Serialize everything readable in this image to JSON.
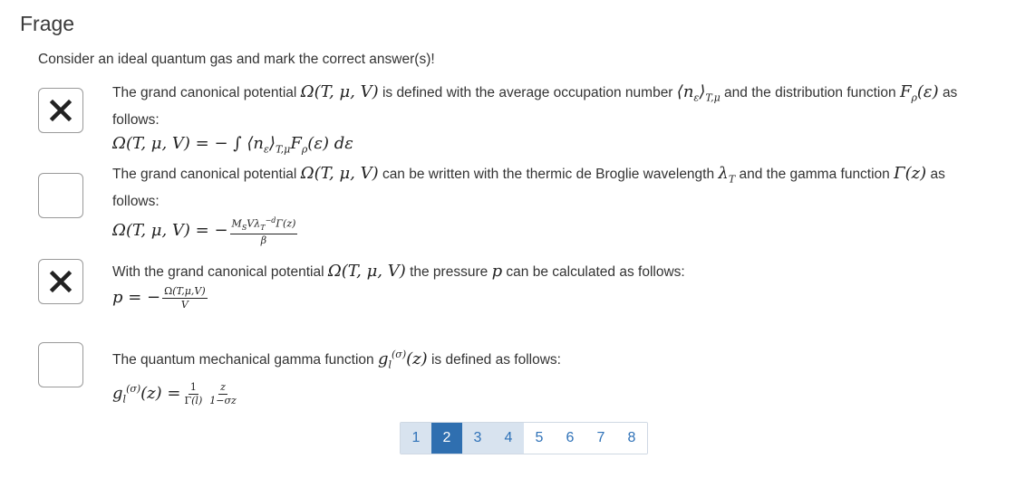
{
  "header": {
    "title": "Frage"
  },
  "question": {
    "text": "Consider an ideal quantum gas and mark the correct answer(s)!"
  },
  "answers": [
    {
      "checked": true,
      "t1": "The grand canonical potential",
      "t2": "is defined with the average occupation number",
      "t3": "and the distribution function",
      "t4": "as",
      "t5": "follows:"
    },
    {
      "checked": false,
      "t1": "The grand canonical potential",
      "t2": "can be written with the thermic de Broglie wavelength",
      "t3": "and the gamma function",
      "t4": "as",
      "t5": "follows:"
    },
    {
      "checked": true,
      "t1": "With the grand canonical potential",
      "t2": "the pressure",
      "t3": "can be calculated as follows:"
    },
    {
      "checked": false,
      "t1": "The quantum mechanical gamma function",
      "t2": "is defined as follows:"
    }
  ],
  "pagination": {
    "pages": [
      "1",
      "2",
      "3",
      "4",
      "5",
      "6",
      "7",
      "8"
    ],
    "current": "2",
    "visited": [
      "1",
      "3",
      "4"
    ]
  },
  "colors": {
    "current_page": "#2f6fb0",
    "visited_page": "#d8e3ef",
    "link": "#2f72b8"
  }
}
